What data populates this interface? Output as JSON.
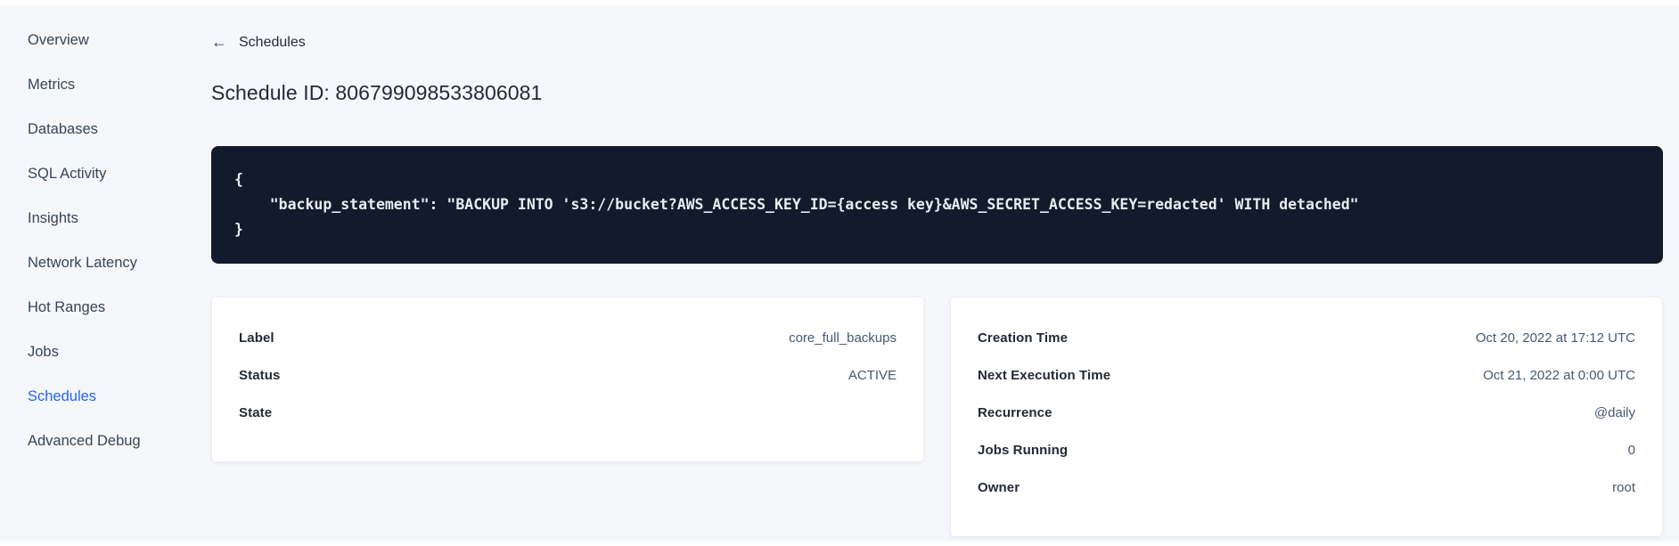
{
  "colors": {
    "accent_link": "#2264f0",
    "page_background": "#f5f7fa",
    "code_background": "#121a2b",
    "code_text": "#e7ecf3"
  },
  "sidebar": {
    "items": [
      {
        "label": "Overview",
        "active": false
      },
      {
        "label": "Metrics",
        "active": false
      },
      {
        "label": "Databases",
        "active": false
      },
      {
        "label": "SQL Activity",
        "active": false
      },
      {
        "label": "Insights",
        "active": false
      },
      {
        "label": "Network Latency",
        "active": false
      },
      {
        "label": "Hot Ranges",
        "active": false
      },
      {
        "label": "Jobs",
        "active": false
      },
      {
        "label": "Schedules",
        "active": true
      },
      {
        "label": "Advanced Debug",
        "active": false
      }
    ]
  },
  "header": {
    "back_icon": "←",
    "back_label": "Schedules",
    "title": "Schedule ID: 806799098533806081"
  },
  "code_block": {
    "lines": [
      "{",
      "    \"backup_statement\": \"BACKUP INTO 's3://bucket?AWS_ACCESS_KEY_ID={access key}&AWS_SECRET_ACCESS_KEY=redacted' WITH detached\"",
      "}"
    ]
  },
  "cards": {
    "left": {
      "rows": [
        {
          "label": "Label",
          "value": "core_full_backups"
        },
        {
          "label": "Status",
          "value": "ACTIVE"
        },
        {
          "label": "State",
          "value": ""
        }
      ]
    },
    "right": {
      "rows": [
        {
          "label": "Creation Time",
          "value": "Oct 20, 2022 at 17:12 UTC"
        },
        {
          "label": "Next Execution Time",
          "value": "Oct 21, 2022 at 0:00 UTC"
        },
        {
          "label": "Recurrence",
          "value": "@daily"
        },
        {
          "label": "Jobs Running",
          "value": "0"
        },
        {
          "label": "Owner",
          "value": "root"
        }
      ]
    }
  }
}
